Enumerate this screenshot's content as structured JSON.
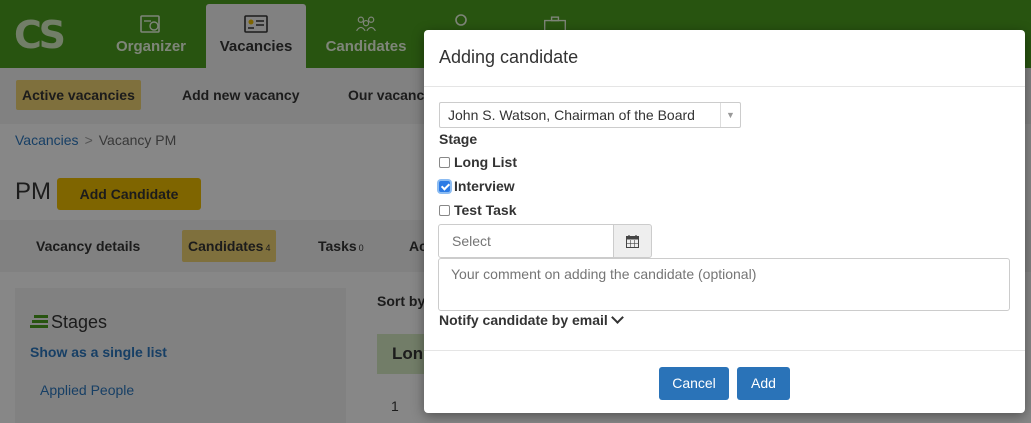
{
  "topnav": {
    "logo": "CS",
    "items": [
      {
        "label": "Organizer",
        "icon": "organizer-icon"
      },
      {
        "label": "Vacancies",
        "icon": "vacancies-icon",
        "active": true
      },
      {
        "label": "Candidates",
        "icon": "candidates-icon"
      },
      {
        "label": "",
        "icon": "person-icon"
      },
      {
        "label": "",
        "icon": "briefcase-icon"
      }
    ]
  },
  "subnav": {
    "active_vacancies": "Active vacancies",
    "add_new_vacancy": "Add new vacancy",
    "our_vacancies": "Our vacanc"
  },
  "breadcrumb": {
    "root": "Vacancies",
    "separator": ">",
    "current": "Vacancy PM"
  },
  "page": {
    "title": "PM",
    "add_candidate_label": "Add Candidate"
  },
  "tabs": [
    {
      "label": "Vacancy details",
      "count": ""
    },
    {
      "label": "Candidates",
      "count": "4"
    },
    {
      "label": "Tasks",
      "count": "0"
    },
    {
      "label": "Ac",
      "count": ""
    }
  ],
  "stages_panel": {
    "title": "Stages",
    "single_list_link": "Show as a single list",
    "applied_link": "Applied People"
  },
  "list": {
    "sort_label": "Sort by",
    "group_header": "Lon",
    "row_number": "1"
  },
  "modal": {
    "title": "Adding candidate",
    "selected_candidate": "John S. Watson, Chairman of the Board",
    "stage_label": "Stage",
    "stages": [
      {
        "label": "Long List",
        "checked": false
      },
      {
        "label": "Interview",
        "checked": true
      },
      {
        "label": "Test Task",
        "checked": false
      }
    ],
    "date_placeholder": "Select",
    "comment_placeholder": "Your comment on adding the candidate (optional)",
    "notify_label": "Notify candidate by email",
    "cancel_label": "Cancel",
    "add_label": "Add"
  },
  "colors": {
    "topbar": "#4a9a1e",
    "primary_button": "#2a73b8",
    "accent_yellow": "#e8b800",
    "active_tab": "#e8cc6f"
  }
}
